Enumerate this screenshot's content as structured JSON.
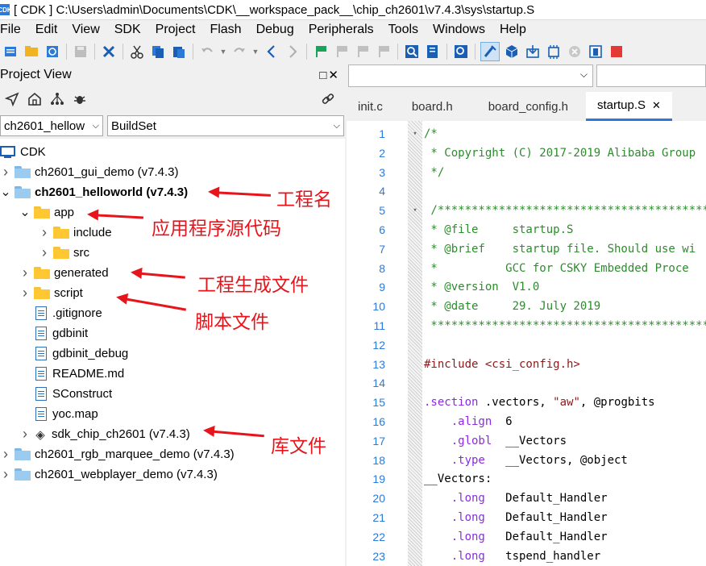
{
  "window": {
    "title": "[ CDK ] C:\\Users\\admin\\Documents\\CDK\\__workspace_pack__\\chip_ch2601\\v7.4.3\\sys\\startup.S",
    "app_icon": "CDK"
  },
  "menu": [
    "File",
    "Edit",
    "View",
    "SDK",
    "Project",
    "Flash",
    "Debug",
    "Peripherals",
    "Tools",
    "Windows",
    "Help"
  ],
  "project_view": {
    "title": "Project View",
    "controls": "□✕",
    "project_select": "ch2601_hellow",
    "build_select": "BuildSet"
  },
  "tree": [
    {
      "label": "CDK",
      "level": 0,
      "type": "root"
    },
    {
      "label": "ch2601_gui_demo (v7.4.3)",
      "level": 1,
      "type": "project",
      "expanded": false
    },
    {
      "label": "ch2601_helloworld (v7.4.3)",
      "level": 1,
      "type": "project",
      "expanded": true,
      "bold": true
    },
    {
      "label": "app",
      "level": 2,
      "type": "folder",
      "expanded": true
    },
    {
      "label": "include",
      "level": 3,
      "type": "folder",
      "expanded": false
    },
    {
      "label": "src",
      "level": 3,
      "type": "folder",
      "expanded": false
    },
    {
      "label": "generated",
      "level": 2,
      "type": "folder",
      "expanded": false
    },
    {
      "label": "script",
      "level": 2,
      "type": "folder",
      "expanded": false
    },
    {
      "label": ".gitignore",
      "level": 2,
      "type": "file"
    },
    {
      "label": "gdbinit",
      "level": 2,
      "type": "file"
    },
    {
      "label": "gdbinit_debug",
      "level": 2,
      "type": "file"
    },
    {
      "label": "README.md",
      "level": 2,
      "type": "file"
    },
    {
      "label": "SConstruct",
      "level": 2,
      "type": "file"
    },
    {
      "label": "yoc.map",
      "level": 2,
      "type": "file"
    },
    {
      "label": "sdk_chip_ch2601 (v7.4.3)",
      "level": 2,
      "type": "lib",
      "expanded": false
    },
    {
      "label": "ch2601_rgb_marquee_demo (v7.4.3)",
      "level": 1,
      "type": "project",
      "expanded": false
    },
    {
      "label": "ch2601_webplayer_demo (v7.4.3)",
      "level": 1,
      "type": "project",
      "expanded": false
    }
  ],
  "annotations": {
    "project_name": "工程名",
    "app_source": "应用程序源代码",
    "generated_files": "工程生成文件",
    "script_files": "脚本文件",
    "library_files": "库文件"
  },
  "editor": {
    "tabs": [
      "init.c",
      "board.h",
      "board_config.h",
      "startup.S"
    ],
    "active_tab": "startup.S",
    "tab_close": "✕",
    "lines": [
      {
        "n": "1",
        "segs": [
          [
            "c-comment",
            "/*"
          ]
        ],
        "fold": true
      },
      {
        "n": "2",
        "segs": [
          [
            "c-comment",
            " * Copyright (C) 2017-2019 Alibaba Group"
          ]
        ]
      },
      {
        "n": "3",
        "segs": [
          [
            "c-comment",
            " */"
          ]
        ]
      },
      {
        "n": "4",
        "segs": [
          [
            "c-plain",
            ""
          ]
        ]
      },
      {
        "n": "5",
        "segs": [
          [
            "c-comment",
            " /*********************************************"
          ]
        ],
        "fold": true
      },
      {
        "n": "6",
        "segs": [
          [
            "c-comment",
            " * @file     startup.S"
          ]
        ]
      },
      {
        "n": "7",
        "segs": [
          [
            "c-comment",
            " * @brief    startup file. Should use wi"
          ]
        ]
      },
      {
        "n": "8",
        "segs": [
          [
            "c-comment",
            " *          GCC for CSKY Embedded Proce"
          ]
        ]
      },
      {
        "n": "9",
        "segs": [
          [
            "c-comment",
            " * @version  V1.0"
          ]
        ]
      },
      {
        "n": "10",
        "segs": [
          [
            "c-comment",
            " * @date     29. July 2019"
          ]
        ]
      },
      {
        "n": "11",
        "segs": [
          [
            "c-comment",
            " *********************************************"
          ]
        ]
      },
      {
        "n": "12",
        "segs": [
          [
            "c-plain",
            ""
          ]
        ]
      },
      {
        "n": "13",
        "segs": [
          [
            "c-dir",
            "#include "
          ],
          [
            "c-str",
            "<csi_config.h>"
          ]
        ]
      },
      {
        "n": "14",
        "segs": [
          [
            "c-plain",
            ""
          ]
        ]
      },
      {
        "n": "15",
        "segs": [
          [
            "c-kw",
            ".section"
          ],
          [
            "c-plain",
            " .vectors, "
          ],
          [
            "c-str",
            "\"aw\""
          ],
          [
            "c-plain",
            ", @progbits"
          ]
        ]
      },
      {
        "n": "16",
        "segs": [
          [
            "c-kw",
            "    .align"
          ],
          [
            "c-plain",
            "  6"
          ]
        ]
      },
      {
        "n": "17",
        "segs": [
          [
            "c-kw",
            "    .globl"
          ],
          [
            "c-plain",
            "  __Vectors"
          ]
        ]
      },
      {
        "n": "18",
        "segs": [
          [
            "c-kw",
            "    .type"
          ],
          [
            "c-plain",
            "   __Vectors, @object"
          ]
        ]
      },
      {
        "n": "19",
        "segs": [
          [
            "c-plain",
            "__Vectors:"
          ]
        ]
      },
      {
        "n": "20",
        "segs": [
          [
            "c-kw",
            "    .long"
          ],
          [
            "c-plain",
            "   Default_Handler"
          ]
        ]
      },
      {
        "n": "21",
        "segs": [
          [
            "c-kw",
            "    .long"
          ],
          [
            "c-plain",
            "   Default_Handler"
          ]
        ]
      },
      {
        "n": "22",
        "segs": [
          [
            "c-kw",
            "    .long"
          ],
          [
            "c-plain",
            "   Default_Handler"
          ]
        ]
      },
      {
        "n": "23",
        "segs": [
          [
            "c-kw",
            "    .long"
          ],
          [
            "c-plain",
            "   tspend_handler"
          ]
        ]
      }
    ]
  },
  "colors": {
    "accent": "#2b79d8",
    "annotation": "#e8141b",
    "folder": "#ffc833",
    "comment": "#2e8b2e"
  }
}
